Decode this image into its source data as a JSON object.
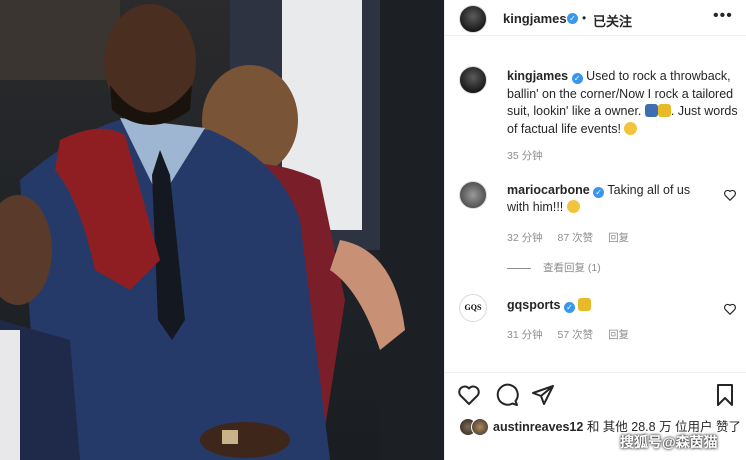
{
  "header": {
    "username": "kingjames",
    "separator": "•",
    "follow_label": "已关注",
    "more_label": "•••"
  },
  "caption": {
    "username": "kingjames",
    "text": "Used to rock a throwback, ballin' on the corner/Now I rock a tailored suit, lookin' like a owner.",
    "text_end": ". Just words of factual life events!",
    "time": "35 分钟"
  },
  "comments": [
    {
      "username": "mariocarbone",
      "text": "Taking all of us with him!!!",
      "time": "32 分钟",
      "likes": "87 次赞",
      "reply": "回复",
      "view_replies": "查看回复 (1)"
    },
    {
      "username": "gqsports",
      "avatar_text": "GQS",
      "time": "31 分钟",
      "likes": "57 次赞",
      "reply": "回复"
    }
  ],
  "likes_summary": {
    "user": "austinreaves12",
    "text": "和 其他 28.8 万 位用户 赞了"
  },
  "watermark": "搜狐号@森茵猫",
  "colors": {
    "verified": "#3797f0",
    "muted": "#8e8e8e",
    "border": "#efefef"
  },
  "icons": [
    "heart-icon",
    "comment-icon",
    "share-icon",
    "bookmark-icon",
    "verified-badge-icon",
    "more-icon"
  ]
}
